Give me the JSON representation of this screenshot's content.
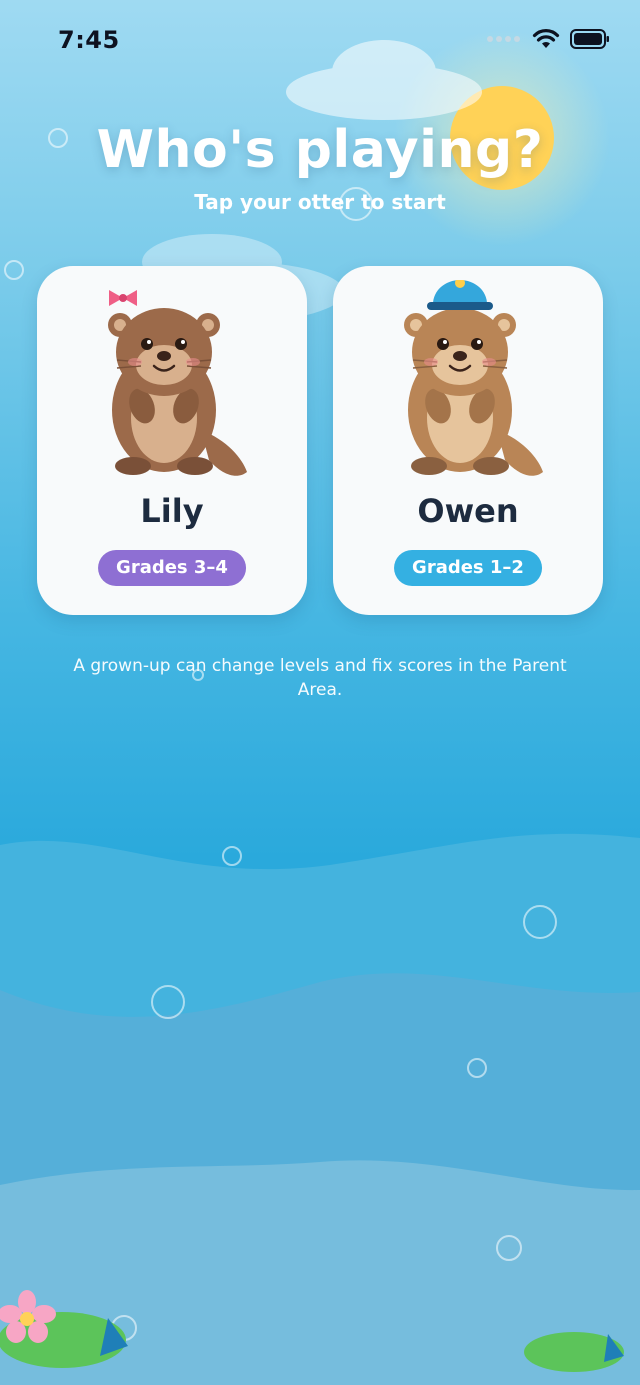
{
  "status_bar": {
    "time": "7:45"
  },
  "header": {
    "title": "Who's playing?",
    "subtitle": "Tap your otter to start"
  },
  "profiles": [
    {
      "name": "Lily",
      "grade": "Grades 3–4",
      "accent": "#8e6fd3",
      "accessory": "pink-bow"
    },
    {
      "name": "Owen",
      "grade": "Grades 1–2",
      "accent": "#34b0e2",
      "accessory": "blue-cap"
    }
  ],
  "footer_note": "A grown-up can change levels and fix scores in the Parent Area."
}
